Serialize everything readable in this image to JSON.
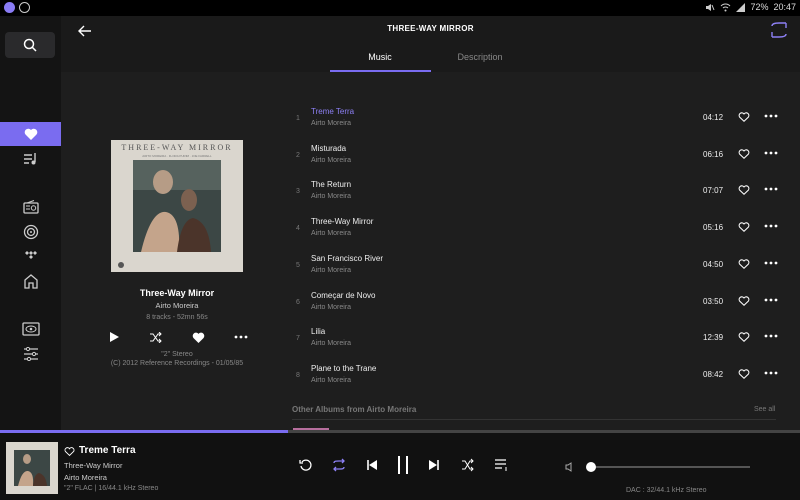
{
  "statusbar": {
    "icons": [
      "app-icon",
      "notification-icon"
    ],
    "right_icons": [
      "mute-icon",
      "wifi-icon",
      "signal-icon"
    ],
    "battery": "72%",
    "time": "20:47"
  },
  "header": {
    "title": "THREE-WAY MIRROR",
    "tabs": [
      "Music",
      "Description"
    ],
    "active_tab": "Music"
  },
  "sidebar": {
    "items": [
      "search-icon",
      "favorites-icon",
      "playlists-icon",
      "radio-icon",
      "podcast-icon",
      "tidal-icon",
      "home-icon",
      "display-icon",
      "settings-icon"
    ],
    "active": "favorites-icon"
  },
  "album": {
    "cover_title": "THREE-WAY MIRROR",
    "cover_names": "AIRTO MOREIRA · FLORA PURIM · JOE FARRELL",
    "title": "Three-Way Mirror",
    "artist": "Airto Moreira",
    "meta": "8 tracks - 52mn 56s",
    "format": "\"2\" Stereo",
    "copyright": "(C) 2012 Reference Recordings - 01/05/85"
  },
  "tracks": [
    {
      "num": "1",
      "title": "Treme Terra",
      "artist": "Airto Moreira",
      "duration": "04:12",
      "playing": true
    },
    {
      "num": "2",
      "title": "Misturada",
      "artist": "Airto Moreira",
      "duration": "06:16"
    },
    {
      "num": "3",
      "title": "The Return",
      "artist": "Airto Moreira",
      "duration": "07:07"
    },
    {
      "num": "4",
      "title": "Three-Way Mirror",
      "artist": "Airto Moreira",
      "duration": "05:16"
    },
    {
      "num": "5",
      "title": "San Francisco River",
      "artist": "Airto Moreira",
      "duration": "04:50"
    },
    {
      "num": "6",
      "title": "Começar de Novo",
      "artist": "Airto Moreira",
      "duration": "03:50"
    },
    {
      "num": "7",
      "title": "Lilia",
      "artist": "Airto Moreira",
      "duration": "12:39"
    },
    {
      "num": "8",
      "title": "Plane to the Trane",
      "artist": "Airto Moreira",
      "duration": "08:42"
    }
  ],
  "other": {
    "title": "Other Albums from Airto Moreira",
    "see_all": "See all"
  },
  "player": {
    "title": "Treme Terra",
    "album": "Three-Way Mirror",
    "artist": "Airto Moreira",
    "format": "\"2\"  FLAC | 16/44.1 kHz Stereo",
    "dac": "DAC : 32/44.1 kHz Stereo",
    "progress": 0.36,
    "volume": 0.0
  },
  "colors": {
    "accent": "#7a6cf0",
    "background": "#1e1e1e",
    "sidebar": "#141414"
  }
}
